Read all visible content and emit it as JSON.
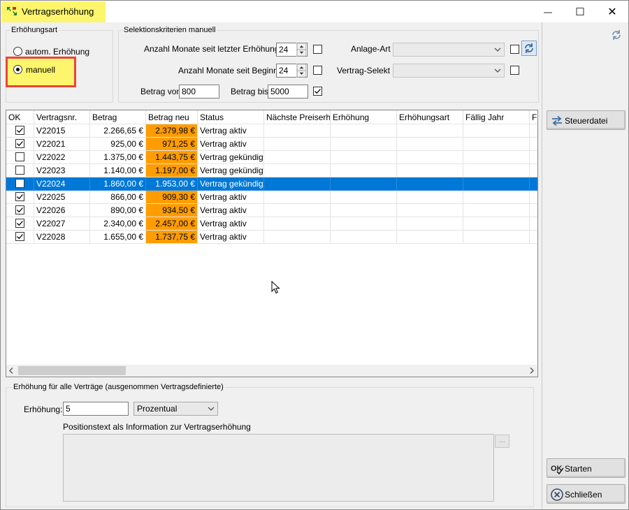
{
  "window": {
    "title": "Vertragserhöhung",
    "minimize": "—",
    "maximize": "☐",
    "close": "✕"
  },
  "erhoehungsart": {
    "label": "Erhöhungsart",
    "option_auto": "autom. Erhöhung",
    "option_manual": "manuell",
    "selected": "manuell"
  },
  "selektion": {
    "label": "Selektionskriterien manuell",
    "monate_letzte_label": "Anzahl Monate seit letzter Erhöhung",
    "monate_letzte_value": "24",
    "monate_beginn_label": "Anzahl Monate seit Beginn",
    "monate_beginn_value": "24",
    "betrag_von_label": "Betrag von",
    "betrag_von_value": "800",
    "betrag_bis_label": "Betrag bis",
    "betrag_bis_value": "5000",
    "anlage_art_label": "Anlage-Art",
    "vertrag_selekt_label": "Vertrag-Selekt"
  },
  "grid": {
    "columns": [
      "OK",
      "Vertragsnr.",
      "Betrag",
      "Betrag neu",
      "Status",
      "Nächste Preiserhö",
      "Erhöhung",
      "Erhöhungsart",
      "Fällig Jahr",
      "Fä"
    ],
    "rows": [
      {
        "ok": true,
        "nr": "V22015",
        "betrag": "2.266,65 €",
        "neu": "2.379,98 €",
        "status": "Vertrag aktiv"
      },
      {
        "ok": true,
        "nr": "V22021",
        "betrag": "925,00 €",
        "neu": "971,25 €",
        "status": "Vertrag aktiv"
      },
      {
        "ok": false,
        "nr": "V22022",
        "betrag": "1.375,00 €",
        "neu": "1.443,75 €",
        "status": "Vertrag gekündigt"
      },
      {
        "ok": false,
        "nr": "V22023",
        "betrag": "1.140,00 €",
        "neu": "1.197,00 €",
        "status": "Vertrag gekündigt"
      },
      {
        "ok": false,
        "nr": "V22024",
        "betrag": "1.860,00 €",
        "neu": "1.953,00 €",
        "status": "Vertrag gekündigt",
        "selected": true
      },
      {
        "ok": true,
        "nr": "V22025",
        "betrag": "866,00 €",
        "neu": "909,30 €",
        "status": "Vertrag aktiv"
      },
      {
        "ok": true,
        "nr": "V22026",
        "betrag": "890,00 €",
        "neu": "934,50 €",
        "status": "Vertrag aktiv"
      },
      {
        "ok": true,
        "nr": "V22027",
        "betrag": "2.340,00 €",
        "neu": "2.457,00 €",
        "status": "Vertrag aktiv"
      },
      {
        "ok": true,
        "nr": "V22028",
        "betrag": "1.655,00 €",
        "neu": "1.737,75 €",
        "status": "Vertrag aktiv"
      }
    ]
  },
  "bottom": {
    "group_label": "Erhöhung für alle Verträge (ausgenommen Vertragsdefinierte)",
    "erhoehung_label": "Erhöhung:",
    "erhoehung_value": "5",
    "art_value": "Prozentual",
    "positionstext_label": "Positionstext als Information zur Vertragserhöhung",
    "dots": "..."
  },
  "buttons": {
    "steuerdatei": "Steuerdatei",
    "starten": "Starten",
    "schliessen": "Schließen"
  },
  "colors": {
    "highlight_yellow": "#fdf56b",
    "red_frame": "#e8453c",
    "betrag_neu_orange": "#ff9d00",
    "selection_blue": "#0078d7"
  }
}
